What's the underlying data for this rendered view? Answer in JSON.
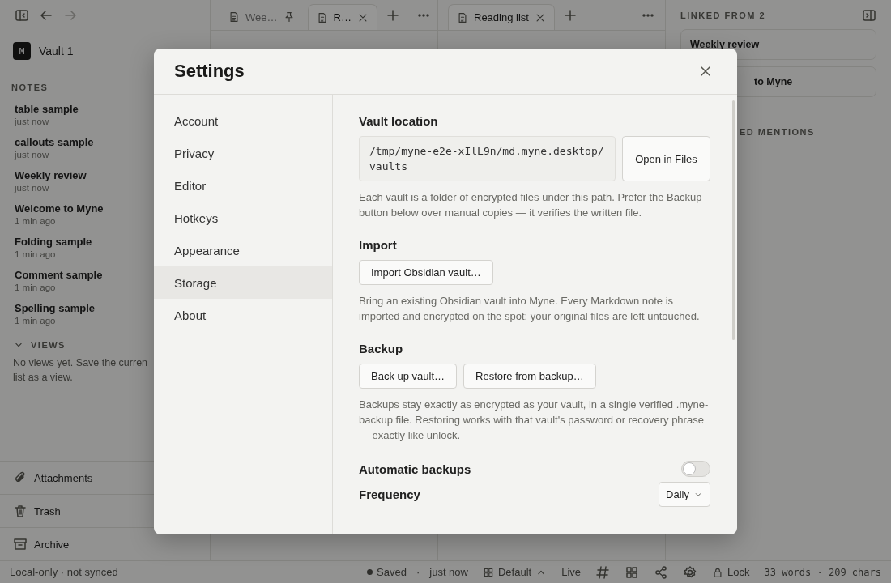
{
  "sidebar": {
    "vault": {
      "initial": "M",
      "name": "Vault 1"
    },
    "notes_heading": "NOTES",
    "notes": [
      {
        "title": "table sample",
        "time": "just now"
      },
      {
        "title": "callouts sample",
        "time": "just now"
      },
      {
        "title": "Weekly review",
        "time": "just now"
      },
      {
        "title": "Welcome to Myne",
        "time": "1 min ago"
      },
      {
        "title": "Folding sample",
        "time": "1 min ago"
      },
      {
        "title": "Comment sample",
        "time": "1 min ago"
      },
      {
        "title": "Spelling sample",
        "time": "1 min ago"
      }
    ],
    "views": {
      "heading": "VIEWS",
      "expanded": true,
      "empty_text": "No views yet. Save the curren\nlist as a view."
    },
    "footer_items": [
      {
        "kind": "attachments",
        "label": "Attachments"
      },
      {
        "kind": "trash",
        "label": "Trash"
      },
      {
        "kind": "archive",
        "label": "Archive"
      }
    ],
    "sync_status": "Local-only · not synced"
  },
  "panes": [
    {
      "tabs": [
        {
          "title": "Wee…",
          "pinned": true,
          "selected": false
        },
        {
          "title": "R…",
          "pinned": false,
          "selected": true
        }
      ]
    },
    {
      "tabs": [
        {
          "title": "Reading list",
          "pinned": false,
          "selected": true
        }
      ]
    }
  ],
  "backlinks": {
    "heading": "LINKED FROM 2",
    "links": [
      "Weekly review",
      "to Myne"
    ],
    "unlinked_heading": "ED MENTIONS"
  },
  "status_bar": {
    "save_state": "Saved",
    "separator": "·",
    "saved_time": "just now",
    "layout": "Default",
    "mode": "Live",
    "lock": "Lock",
    "counts": "33 words · 209 chars"
  },
  "settings": {
    "title": "Settings",
    "nav": [
      {
        "label": "Account",
        "selected": false
      },
      {
        "label": "Privacy",
        "selected": false
      },
      {
        "label": "Editor",
        "selected": false
      },
      {
        "label": "Hotkeys",
        "selected": false
      },
      {
        "label": "Appearance",
        "selected": false
      },
      {
        "label": "Storage",
        "selected": true
      },
      {
        "label": "About",
        "selected": false
      }
    ],
    "sections": [
      {
        "kind": "path",
        "label": "Vault location",
        "value": "/tmp/myne-e2e-xIlL9n/md.myne.desktop/vaults",
        "button": "Open in Files",
        "help": "Each vault is a folder of encrypted files under this path. Prefer the Backup button below over manual copies — it verifies the written file."
      },
      {
        "kind": "buttons",
        "label": "Import",
        "buttons": [
          "Import Obsidian vault…"
        ],
        "help": "Bring an existing Obsidian vault into Myne. Every Markdown note is imported and encrypted on the spot; your original files are left untouched."
      },
      {
        "kind": "buttons",
        "label": "Backup",
        "buttons": [
          "Back up vault…",
          "Restore from backup…"
        ],
        "help": "Backups stay exactly as encrypted as your vault, in a single verified .myne-backup file. Restoring works with that vault's password or recovery phrase — exactly like unlock."
      },
      {
        "kind": "toggle",
        "label": "Automatic backups",
        "on": false
      },
      {
        "kind": "select",
        "label": "Frequency",
        "value": "Daily"
      }
    ]
  }
}
